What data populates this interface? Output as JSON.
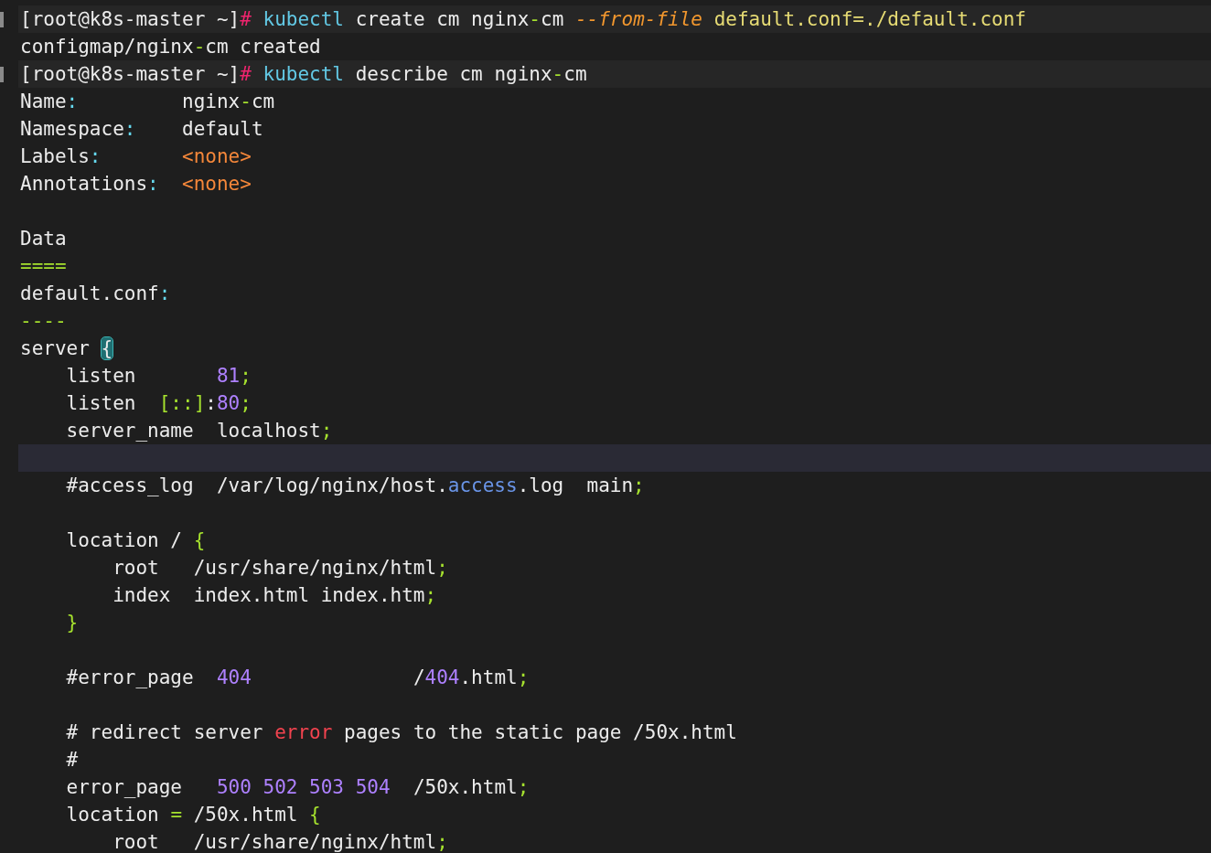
{
  "terminal": {
    "lines": [
      {
        "kind": "command",
        "segments": [
          {
            "text": "[root@k8s-master ~]",
            "kind": "plain"
          },
          {
            "text": "# ",
            "kind": "hash"
          },
          {
            "text": "kubectl",
            "kind": "command"
          },
          {
            "text": " create cm nginx",
            "kind": "plain"
          },
          {
            "text": "-",
            "kind": "operator"
          },
          {
            "text": "cm ",
            "kind": "plain"
          },
          {
            "text": "--from-file",
            "kind": "flag"
          },
          {
            "text": " default.conf=./default.conf",
            "kind": "argument"
          }
        ]
      },
      {
        "kind": "output",
        "segments": [
          {
            "text": "configmap/nginx",
            "kind": "plain"
          },
          {
            "text": "-",
            "kind": "operator"
          },
          {
            "text": "cm created",
            "kind": "plain"
          }
        ]
      },
      {
        "kind": "command",
        "segments": [
          {
            "text": "[root@k8s-master ~]",
            "kind": "plain"
          },
          {
            "text": "# ",
            "kind": "hash"
          },
          {
            "text": "kubectl",
            "kind": "command"
          },
          {
            "text": " describe cm nginx",
            "kind": "plain"
          },
          {
            "text": "-",
            "kind": "operator"
          },
          {
            "text": "cm",
            "kind": "plain"
          }
        ]
      },
      {
        "kind": "output",
        "segments": [
          {
            "text": "Name",
            "kind": "plain"
          },
          {
            "text": ":",
            "kind": "colon"
          },
          {
            "text": "         nginx",
            "kind": "plain"
          },
          {
            "text": "-",
            "kind": "operator"
          },
          {
            "text": "cm",
            "kind": "plain"
          }
        ]
      },
      {
        "kind": "output",
        "segments": [
          {
            "text": "Namespace",
            "kind": "plain"
          },
          {
            "text": ":",
            "kind": "colon"
          },
          {
            "text": "    default",
            "kind": "plain"
          }
        ]
      },
      {
        "kind": "output",
        "segments": [
          {
            "text": "Labels",
            "kind": "plain"
          },
          {
            "text": ":       ",
            "kind": "colon"
          },
          {
            "text": "<none>",
            "kind": "special"
          }
        ]
      },
      {
        "kind": "output",
        "segments": [
          {
            "text": "Annotations",
            "kind": "plain"
          },
          {
            "text": ":  ",
            "kind": "colon"
          },
          {
            "text": "<none>",
            "kind": "special"
          }
        ]
      },
      {
        "kind": "output"
      },
      {
        "kind": "output",
        "segments": [
          {
            "text": "Data",
            "kind": "plain"
          }
        ]
      },
      {
        "kind": "output",
        "segments": [
          {
            "text": "====",
            "kind": "operator"
          }
        ]
      },
      {
        "kind": "output",
        "segments": [
          {
            "text": "default.conf",
            "kind": "plain"
          },
          {
            "text": ":",
            "kind": "colon"
          }
        ]
      },
      {
        "kind": "output",
        "segments": [
          {
            "text": "----",
            "kind": "operator"
          }
        ]
      },
      {
        "kind": "output",
        "segments": [
          {
            "text": "server ",
            "kind": "plain"
          },
          {
            "text": "{",
            "kind": "bracket-match"
          }
        ]
      },
      {
        "kind": "output",
        "segments": [
          {
            "text": "    listen       ",
            "kind": "plain"
          },
          {
            "text": "81",
            "kind": "number"
          },
          {
            "text": ";",
            "kind": "operator"
          }
        ]
      },
      {
        "kind": "output",
        "segments": [
          {
            "text": "    listen  ",
            "kind": "plain"
          },
          {
            "text": "[::]",
            "kind": "operator"
          },
          {
            "text": ":",
            "kind": "plain"
          },
          {
            "text": "80",
            "kind": "number"
          },
          {
            "text": ";",
            "kind": "operator"
          }
        ]
      },
      {
        "kind": "output",
        "segments": [
          {
            "text": "    server_name  localhost",
            "kind": "plain"
          },
          {
            "text": ";",
            "kind": "operator"
          }
        ]
      },
      {
        "kind": "current"
      },
      {
        "kind": "output",
        "segments": [
          {
            "text": "    #access_log  /var/log/nginx/host.",
            "kind": "plain"
          },
          {
            "text": "access",
            "kind": "keyword"
          },
          {
            "text": ".log  main",
            "kind": "plain"
          },
          {
            "text": ";",
            "kind": "operator"
          }
        ]
      },
      {
        "kind": "output"
      },
      {
        "kind": "output",
        "segments": [
          {
            "text": "    location / ",
            "kind": "plain"
          },
          {
            "text": "{",
            "kind": "operator"
          }
        ]
      },
      {
        "kind": "output",
        "segments": [
          {
            "text": "        root   /usr/share/nginx/html",
            "kind": "plain"
          },
          {
            "text": ";",
            "kind": "operator"
          }
        ]
      },
      {
        "kind": "output",
        "segments": [
          {
            "text": "        index  index.html index.htm",
            "kind": "plain"
          },
          {
            "text": ";",
            "kind": "operator"
          }
        ]
      },
      {
        "kind": "output",
        "segments": [
          {
            "text": "    }",
            "kind": "operator"
          }
        ]
      },
      {
        "kind": "output"
      },
      {
        "kind": "output",
        "segments": [
          {
            "text": "    #error_page  ",
            "kind": "plain"
          },
          {
            "text": "404",
            "kind": "number"
          },
          {
            "text": "              /",
            "kind": "plain"
          },
          {
            "text": "404",
            "kind": "number"
          },
          {
            "text": ".html",
            "kind": "plain"
          },
          {
            "text": ";",
            "kind": "operator"
          }
        ]
      },
      {
        "kind": "output"
      },
      {
        "kind": "output",
        "segments": [
          {
            "text": "    # redirect server ",
            "kind": "plain"
          },
          {
            "text": "error",
            "kind": "error"
          },
          {
            "text": " pages to the static page /50x.html",
            "kind": "plain"
          }
        ]
      },
      {
        "kind": "output",
        "segments": [
          {
            "text": "    #",
            "kind": "plain"
          }
        ]
      },
      {
        "kind": "output",
        "segments": [
          {
            "text": "    error_page   ",
            "kind": "plain"
          },
          {
            "text": "500 502 503 504",
            "kind": "number"
          },
          {
            "text": "  /50x.html",
            "kind": "plain"
          },
          {
            "text": ";",
            "kind": "operator"
          }
        ]
      },
      {
        "kind": "output",
        "segments": [
          {
            "text": "    location ",
            "kind": "plain"
          },
          {
            "text": "=",
            "kind": "operator"
          },
          {
            "text": " /50x.html ",
            "kind": "plain"
          },
          {
            "text": "{",
            "kind": "operator"
          }
        ]
      },
      {
        "kind": "output",
        "segments": [
          {
            "text": "        root   /usr/share/nginx/html",
            "kind": "plain"
          },
          {
            "text": ";",
            "kind": "operator"
          }
        ]
      }
    ]
  }
}
